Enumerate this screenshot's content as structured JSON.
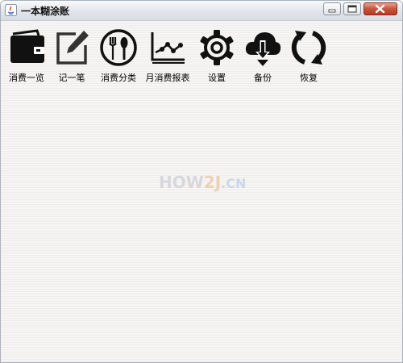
{
  "window": {
    "title": "一本糊涂账"
  },
  "toolbar": {
    "items": [
      {
        "label": "消费一览",
        "icon": "wallet-icon"
      },
      {
        "label": "记一笔",
        "icon": "edit-icon"
      },
      {
        "label": "消费分类",
        "icon": "fork-knife-plate-icon"
      },
      {
        "label": "月消费报表",
        "icon": "line-chart-icon"
      },
      {
        "label": "设置",
        "icon": "gear-icon"
      },
      {
        "label": "备份",
        "icon": "cloud-download-icon"
      },
      {
        "label": "恢复",
        "icon": "refresh-icon"
      }
    ]
  },
  "watermark": {
    "part1": "HOW",
    "part2": "2J",
    "part3": ".CN"
  }
}
